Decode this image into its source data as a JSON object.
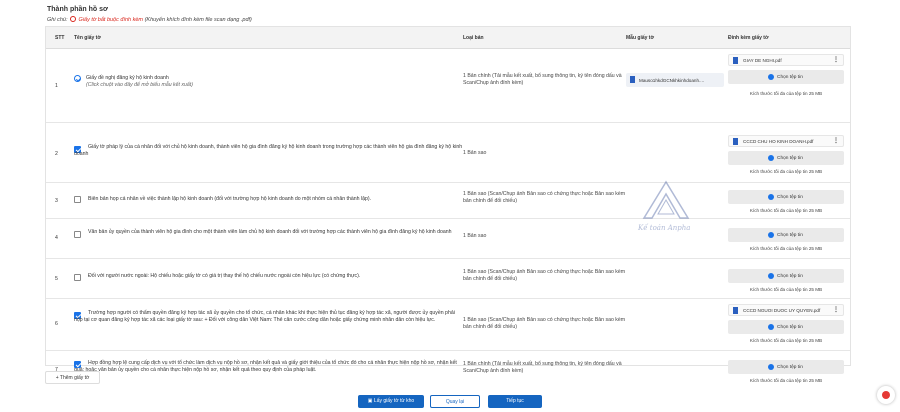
{
  "section_title": "Thành phần hồ sơ",
  "note_prefix": "Ghi chú:",
  "note_required": "Giấy tờ bắt buộc đính kèm",
  "note_hint": "(Khuyến khích đính kèm file scan dạng .pdf)",
  "headers": {
    "stt": "STT",
    "name": "Tên giấy tờ",
    "type": "Loại bản",
    "template": "Mẫu giấy tờ",
    "attach": "Đính kèm giấy tờ"
  },
  "rows": [
    {
      "stt": "1",
      "name": "Giấy đề nghị đăng ký hộ kinh doanh",
      "hint": "(Click chuột vào đây để mở biểu mẫu kết xuất)",
      "type": "1 Bản chính (Tải mẫu kết xuất, bổ sung thông tin, ký tên đóng dấu và Scan/Chụp ảnh đính kèm)",
      "template": "Mauso1hkdGCNkhkinhdoanh....",
      "file": "GIAY DE NGHI.pdf"
    },
    {
      "stt": "2",
      "name": "Giấy tờ pháp lý của cá nhân đối với chủ hộ kinh doanh, thành viên hộ gia đình đăng ký hộ kinh doanh trong trường hợp các thành viên hộ gia đình đăng ký hộ kinh doanh",
      "type": "1 Bản sao",
      "file": "CCCD CHU HO KINH DOANH.pdf"
    },
    {
      "stt": "3",
      "name": "Biên bản họp cá nhân về việc thành lập hộ kinh doanh (đối với trường hợp hộ kinh doanh do một nhóm cá nhân thành lập).",
      "type": "1 Bản sao (Scan/Chụp ảnh Bản sao có chứng thực hoặc Bản sao kèm bản chính để đối chiếu)"
    },
    {
      "stt": "4",
      "name": "Văn bản ủy quyền của thành viên hộ gia đình cho một thành viên làm chủ hộ kinh doanh đối với trường hợp các thành viên hộ gia đình đăng ký hộ kinh doanh",
      "type": "1 Bản sao"
    },
    {
      "stt": "5",
      "name": "Đối với người nước ngoài: Hộ chiếu hoặc giấy tờ có giá trị thay thế hộ chiếu nước ngoài còn hiệu lực (có chứng thực).",
      "type": "1 Bản sao (Scan/Chụp ảnh Bản sao có chứng thực hoặc Bản sao kèm bản chính để đối chiếu)"
    },
    {
      "stt": "6",
      "name": "Trường hợp người có thẩm quyền đăng ký hợp tác xã ủy quyền cho tổ chức, cá nhân khác khi thực hiện thủ tục đăng ký hợp tác xã, người được ủy quyền phải nộp tại cơ quan đăng ký hợp tác xã các loại giấy tờ sau: + Đối với công dân Việt Nam: Thẻ căn cước công dân hoặc giấy chứng minh nhân dân còn hiệu lực.",
      "type": "1 Bản sao (Scan/Chụp ảnh Bản sao có chứng thực hoặc Bản sao kèm bản chính để đối chiếu)",
      "file": "CCCD NGUOI DUOC UY QUYEN.pdf"
    },
    {
      "stt": "7",
      "name": "Hợp đồng hợp lệ cung cấp dịch vụ với tổ chức làm dịch vụ nộp hồ sơ, nhận kết quả và giấy giới thiệu của tổ chức đó cho cá nhân thực hiện nộp hồ sơ, nhận kết quả; hoặc văn bản ủy quyền cho cá nhân thực hiện nộp hồ sơ, nhận kết quả theo quy định của pháp luật.",
      "type": "1 Bản chính (Tải mẫu kết xuất, bổ sung thông tin, ký tên đóng dấu và Scan/Chụp ảnh đính kèm)"
    }
  ],
  "choose_file": "Chọn tệp tin",
  "size_limit": "Kích thước tối đa của tệp tin 25 MB",
  "add_doc": "+ Thêm giấy tờ",
  "btn_repo": "Lấy giấy tờ từ kho",
  "btn_back": "Quay lại",
  "btn_next": "Tiếp tục",
  "watermark": "Kế toán Anpha"
}
